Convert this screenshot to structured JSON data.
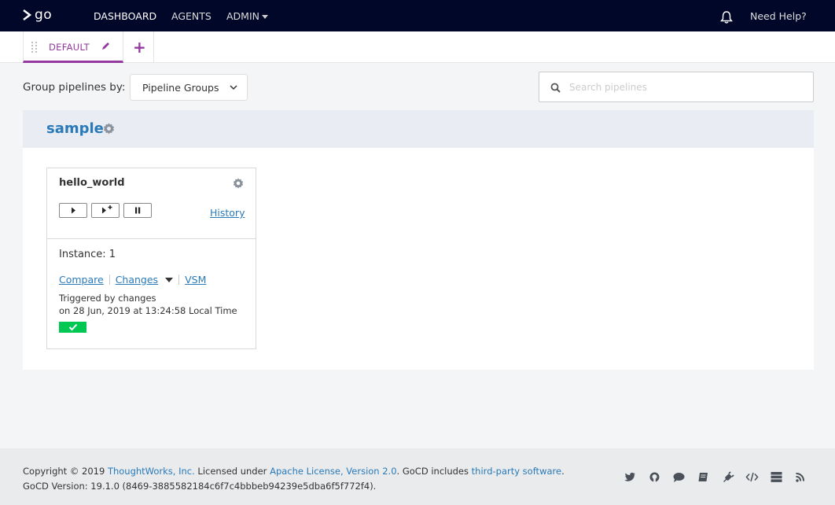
{
  "nav": {
    "logo_text": "go",
    "items": [
      "DASHBOARD",
      "AGENTS",
      "ADMIN"
    ],
    "help": "Need Help?"
  },
  "tabs": {
    "active": "DEFAULT",
    "add_symbol": "+"
  },
  "toolbar": {
    "group_label": "Group pipelines by:",
    "group_value": "Pipeline Groups",
    "search_placeholder": "Search pipelines"
  },
  "group": {
    "name": "sample",
    "pipeline": {
      "name": "hello_world",
      "history": "History",
      "instance": "Instance: 1",
      "links": [
        "Compare",
        "Changes",
        "VSM"
      ],
      "triggered_by": "Triggered by changes",
      "triggered_on": "on 28 Jun, 2019 at 13:24:58 Local Time",
      "stage_color": "#00c853"
    }
  },
  "footer": {
    "copyright_prefix": "Copyright © 2019",
    "thoughtworks": "ThoughtWorks, Inc.",
    "licensed": "Licensed under",
    "license": "Apache License, Version 2.0",
    "includes": ". GoCD includes",
    "third_party": "third-party software",
    "end": ".",
    "version": "GoCD Version: 19.1.0 (8469-3885582184c6f7c4bbbeb94239e5dba6f5f772f4).",
    "icons": [
      "twitter-icon",
      "github-icon",
      "chat-icon",
      "book-icon",
      "plugin-icon",
      "api-icon",
      "server-icon",
      "rss-icon"
    ]
  },
  "colors": {
    "topbar": "#000728",
    "accent": "#943a9e",
    "link": "#2a7ab8",
    "passed": "#00c853"
  }
}
